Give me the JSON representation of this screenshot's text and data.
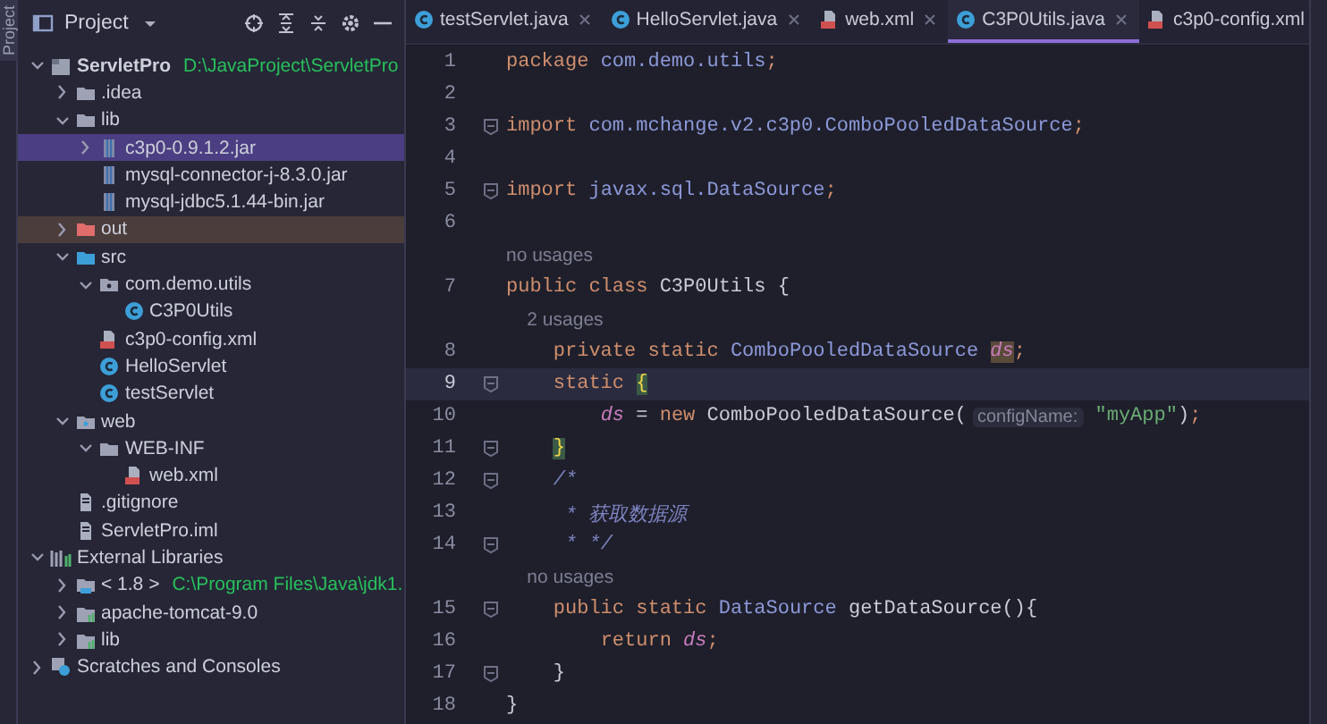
{
  "tool_strip": {
    "label": "Project"
  },
  "project_panel": {
    "title": "Project",
    "tree": [
      {
        "label": "ServletPro",
        "kind": "project",
        "path": "D:\\JavaProject\\ServletPro",
        "expanded": true,
        "selected": false,
        "children": [
          {
            "label": ".idea",
            "kind": "folder",
            "expanded": false,
            "selected": false
          },
          {
            "label": "lib",
            "kind": "folder",
            "expanded": true,
            "selected": false,
            "children": [
              {
                "label": "c3p0-0.9.1.2.jar",
                "kind": "jar",
                "expanded": false,
                "selected": true
              },
              {
                "label": "mysql-connector-j-8.3.0.jar",
                "kind": "jar",
                "selected": false
              },
              {
                "label": "mysql-jdbc5.1.44-bin.jar",
                "kind": "jar",
                "selected": false
              }
            ]
          },
          {
            "label": "out",
            "kind": "excluded",
            "expanded": false,
            "selected": false
          },
          {
            "label": "src",
            "kind": "source",
            "expanded": true,
            "selected": false,
            "children": [
              {
                "label": "com.demo.utils",
                "kind": "package",
                "expanded": true,
                "selected": false,
                "children": [
                  {
                    "label": "C3P0Utils",
                    "kind": "class",
                    "selected": false
                  }
                ]
              },
              {
                "label": "c3p0-config.xml",
                "kind": "xml",
                "selected": false
              },
              {
                "label": "HelloServlet",
                "kind": "class",
                "selected": false
              },
              {
                "label": "testServlet",
                "kind": "class",
                "selected": false
              }
            ]
          },
          {
            "label": "web",
            "kind": "web",
            "expanded": true,
            "selected": false,
            "children": [
              {
                "label": "WEB-INF",
                "kind": "folder",
                "expanded": true,
                "selected": false,
                "children": [
                  {
                    "label": "web.xml",
                    "kind": "xml",
                    "selected": false
                  }
                ]
              }
            ]
          },
          {
            "label": ".gitignore",
            "kind": "file",
            "selected": false
          },
          {
            "label": "ServletPro.iml",
            "kind": "file",
            "selected": false
          }
        ]
      },
      {
        "label": "External Libraries",
        "kind": "libraries",
        "expanded": true,
        "selected": false,
        "children": [
          {
            "label": "< 1.8 >",
            "kind": "sdk",
            "path": "C:\\Program Files\\Java\\jdk1.",
            "expanded": false,
            "selected": false
          },
          {
            "label": "apache-tomcat-9.0",
            "kind": "library",
            "expanded": false,
            "selected": false
          },
          {
            "label": "lib",
            "kind": "library",
            "expanded": false,
            "selected": false
          }
        ]
      },
      {
        "label": "Scratches and Consoles",
        "kind": "scratches",
        "expanded": false,
        "selected": false
      }
    ]
  },
  "tabs": [
    {
      "label": "testServlet.java",
      "kind": "class",
      "selected": false
    },
    {
      "label": "HelloServlet.java",
      "kind": "class",
      "selected": false
    },
    {
      "label": "web.xml",
      "kind": "xml",
      "selected": false
    },
    {
      "label": "C3P0Utils.java",
      "kind": "class",
      "selected": true
    },
    {
      "label": "c3p0-config.xml",
      "kind": "xml",
      "selected": false
    }
  ],
  "editor": {
    "lines": [
      {
        "kind": "code",
        "number": "1",
        "fold": false,
        "current": false,
        "tokens": [
          {
            "kind": "keyword",
            "text": "package "
          },
          {
            "kind": "name",
            "text": "com.demo.utils"
          },
          {
            "kind": "keyword",
            "text": ";"
          }
        ]
      },
      {
        "kind": "code",
        "number": "2",
        "fold": false,
        "current": false
      },
      {
        "kind": "code",
        "number": "3",
        "fold": true,
        "current": false,
        "tokens": [
          {
            "kind": "keyword",
            "text": "import "
          },
          {
            "kind": "name",
            "text": "com.mchange.v2.c3p0.ComboPooledDataSource"
          },
          {
            "kind": "keyword",
            "text": ";"
          }
        ]
      },
      {
        "kind": "code",
        "number": "4",
        "fold": false,
        "current": false
      },
      {
        "kind": "code",
        "number": "5",
        "fold": true,
        "current": false,
        "tokens": [
          {
            "kind": "keyword",
            "text": "import "
          },
          {
            "kind": "name",
            "text": "javax.sql.DataSource"
          },
          {
            "kind": "keyword",
            "text": ";"
          }
        ]
      },
      {
        "kind": "code",
        "number": "6",
        "fold": false,
        "current": false
      },
      {
        "kind": "hint",
        "text": "no usages"
      },
      {
        "kind": "code",
        "number": "7",
        "fold": false,
        "current": false,
        "tokens": [
          {
            "kind": "keyword",
            "text": "public class "
          },
          {
            "kind": "text",
            "text": "C3P0Utils {"
          }
        ]
      },
      {
        "kind": "hint",
        "text": "    2 usages"
      },
      {
        "kind": "code",
        "number": "8",
        "fold": false,
        "current": false,
        "tokens": [
          {
            "kind": "keyword",
            "text": "    private static "
          },
          {
            "kind": "name",
            "text": "ComboPooledDataSource "
          },
          {
            "kind": "marked-field",
            "text": "ds"
          },
          {
            "kind": "keyword",
            "text": ";"
          }
        ]
      },
      {
        "kind": "code",
        "number": "9",
        "fold": true,
        "current": true,
        "tokens": [
          {
            "kind": "keyword",
            "text": "    static "
          },
          {
            "kind": "brace",
            "text": "{"
          }
        ]
      },
      {
        "kind": "code",
        "number": "10",
        "fold": false,
        "current": false,
        "tokens": [
          {
            "kind": "field",
            "text": "        ds"
          },
          {
            "kind": "text",
            "text": " = "
          },
          {
            "kind": "keyword",
            "text": "new "
          },
          {
            "kind": "text",
            "text": "ComboPooledDataSource("
          },
          {
            "kind": "inlay",
            "text": "configName:"
          },
          {
            "kind": "string",
            "text": " \"myApp\""
          },
          {
            "kind": "text",
            "text": ")"
          },
          {
            "kind": "keyword",
            "text": ";"
          }
        ]
      },
      {
        "kind": "code",
        "number": "11",
        "fold": true,
        "current": false,
        "tokens": [
          {
            "kind": "brace",
            "text": "    }"
          }
        ]
      },
      {
        "kind": "code",
        "number": "12",
        "fold": true,
        "current": false,
        "tokens": [
          {
            "kind": "comment",
            "text": "    /*"
          }
        ]
      },
      {
        "kind": "code",
        "number": "13",
        "fold": false,
        "current": false,
        "tokens": [
          {
            "kind": "comment",
            "text": "     * 获取数据源"
          }
        ]
      },
      {
        "kind": "code",
        "number": "14",
        "fold": true,
        "current": false,
        "tokens": [
          {
            "kind": "comment",
            "text": "     * */"
          }
        ]
      },
      {
        "kind": "hint",
        "text": "    no usages"
      },
      {
        "kind": "code",
        "number": "15",
        "fold": true,
        "current": false,
        "tokens": [
          {
            "kind": "keyword",
            "text": "    public static "
          },
          {
            "kind": "name",
            "text": "DataSource"
          },
          {
            "kind": "text",
            "text": " getDataSource(){"
          }
        ]
      },
      {
        "kind": "code",
        "number": "16",
        "fold": false,
        "current": false,
        "tokens": [
          {
            "kind": "keyword",
            "text": "        return "
          },
          {
            "kind": "field",
            "text": "ds"
          },
          {
            "kind": "keyword",
            "text": ";"
          }
        ]
      },
      {
        "kind": "code",
        "number": "17",
        "fold": true,
        "current": false,
        "tokens": [
          {
            "kind": "text",
            "text": "    }"
          }
        ]
      },
      {
        "kind": "code",
        "number": "18",
        "fold": false,
        "current": false,
        "tokens": [
          {
            "kind": "text",
            "text": "}"
          }
        ]
      }
    ]
  }
}
